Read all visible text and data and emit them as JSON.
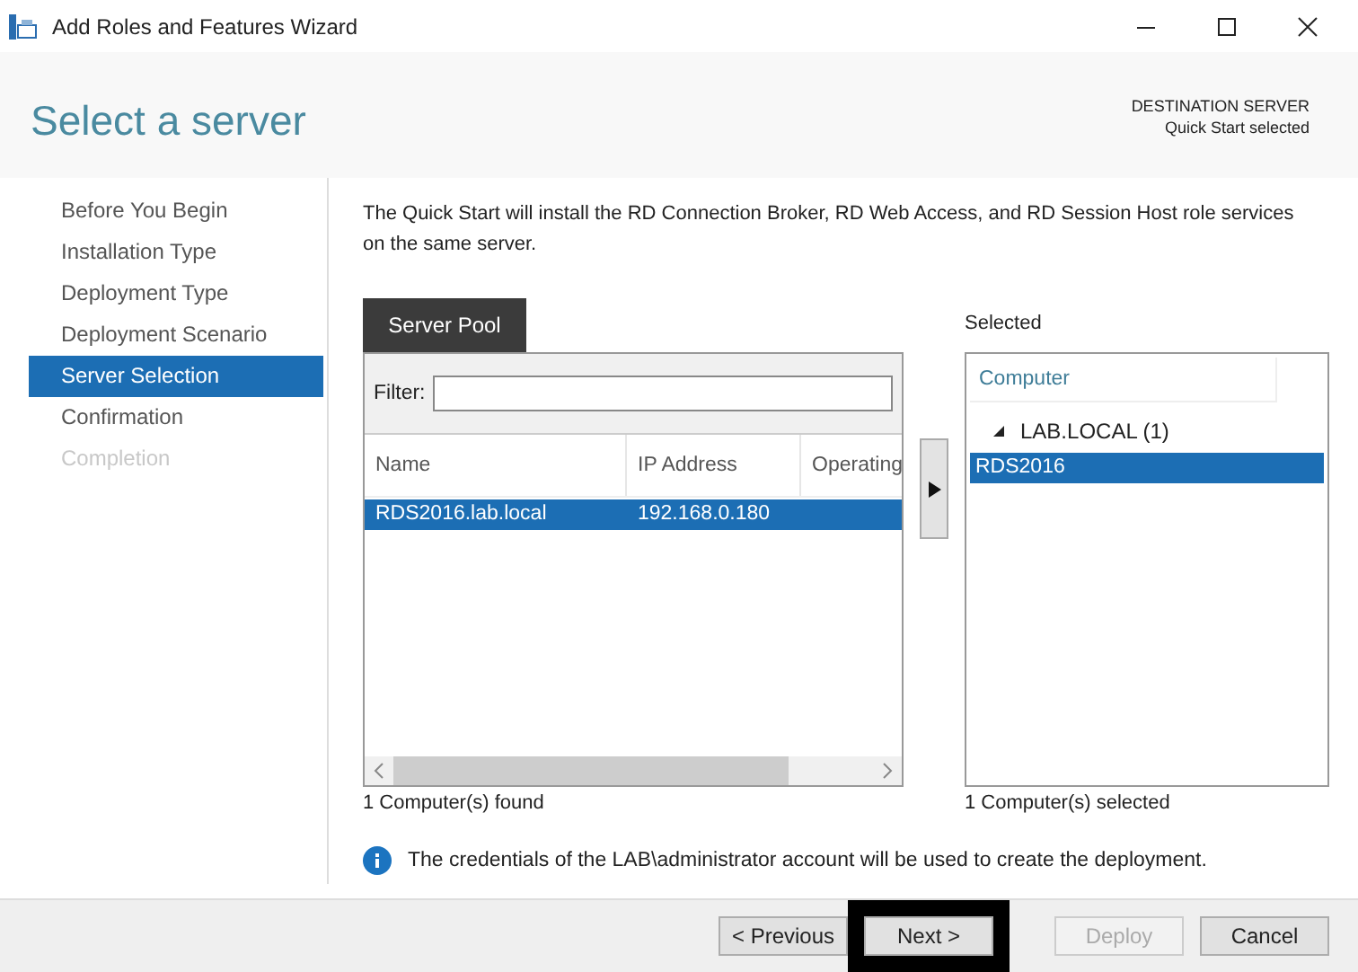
{
  "window": {
    "title": "Add Roles and Features Wizard"
  },
  "header": {
    "title": "Select a server",
    "destination_label": "DESTINATION SERVER",
    "destination_value": "Quick Start selected"
  },
  "steps": [
    {
      "label": "Before You Begin",
      "selected": false,
      "disabled": false
    },
    {
      "label": "Installation Type",
      "selected": false,
      "disabled": false
    },
    {
      "label": "Deployment Type",
      "selected": false,
      "disabled": false
    },
    {
      "label": "Deployment Scenario",
      "selected": false,
      "disabled": false
    },
    {
      "label": "Server Selection",
      "selected": true,
      "disabled": false
    },
    {
      "label": "Confirmation",
      "selected": false,
      "disabled": false
    },
    {
      "label": "Completion",
      "selected": false,
      "disabled": true
    }
  ],
  "description": "The Quick Start will install the RD Connection Broker, RD Web Access, and RD Session Host role services on the same server.",
  "server_pool": {
    "tab": "Server Pool",
    "filter_label": "Filter:",
    "columns": [
      "Name",
      "IP Address",
      "Operating"
    ],
    "rows": [
      {
        "cells": [
          "RDS2016.lab.local",
          "192.168.0.180"
        ],
        "selected": true
      }
    ],
    "status": "1 Computer(s) found"
  },
  "selected_pane": {
    "label": "Selected",
    "column": "Computer",
    "groups": [
      {
        "label": "LAB.LOCAL (1)",
        "expanded": true,
        "children": [
          {
            "label": "RDS2016",
            "selected": true
          }
        ]
      }
    ],
    "status": "1 Computer(s) selected"
  },
  "info": "The credentials of the LAB\\administrator account will be used to create the deployment.",
  "buttons": [
    {
      "label": "< Previous",
      "disabled": false,
      "highlighted": false
    },
    {
      "label": "Next >",
      "disabled": false,
      "highlighted": true
    },
    {
      "label": "Deploy",
      "disabled": true,
      "highlighted": false
    },
    {
      "label": "Cancel",
      "disabled": false,
      "highlighted": false
    }
  ]
}
